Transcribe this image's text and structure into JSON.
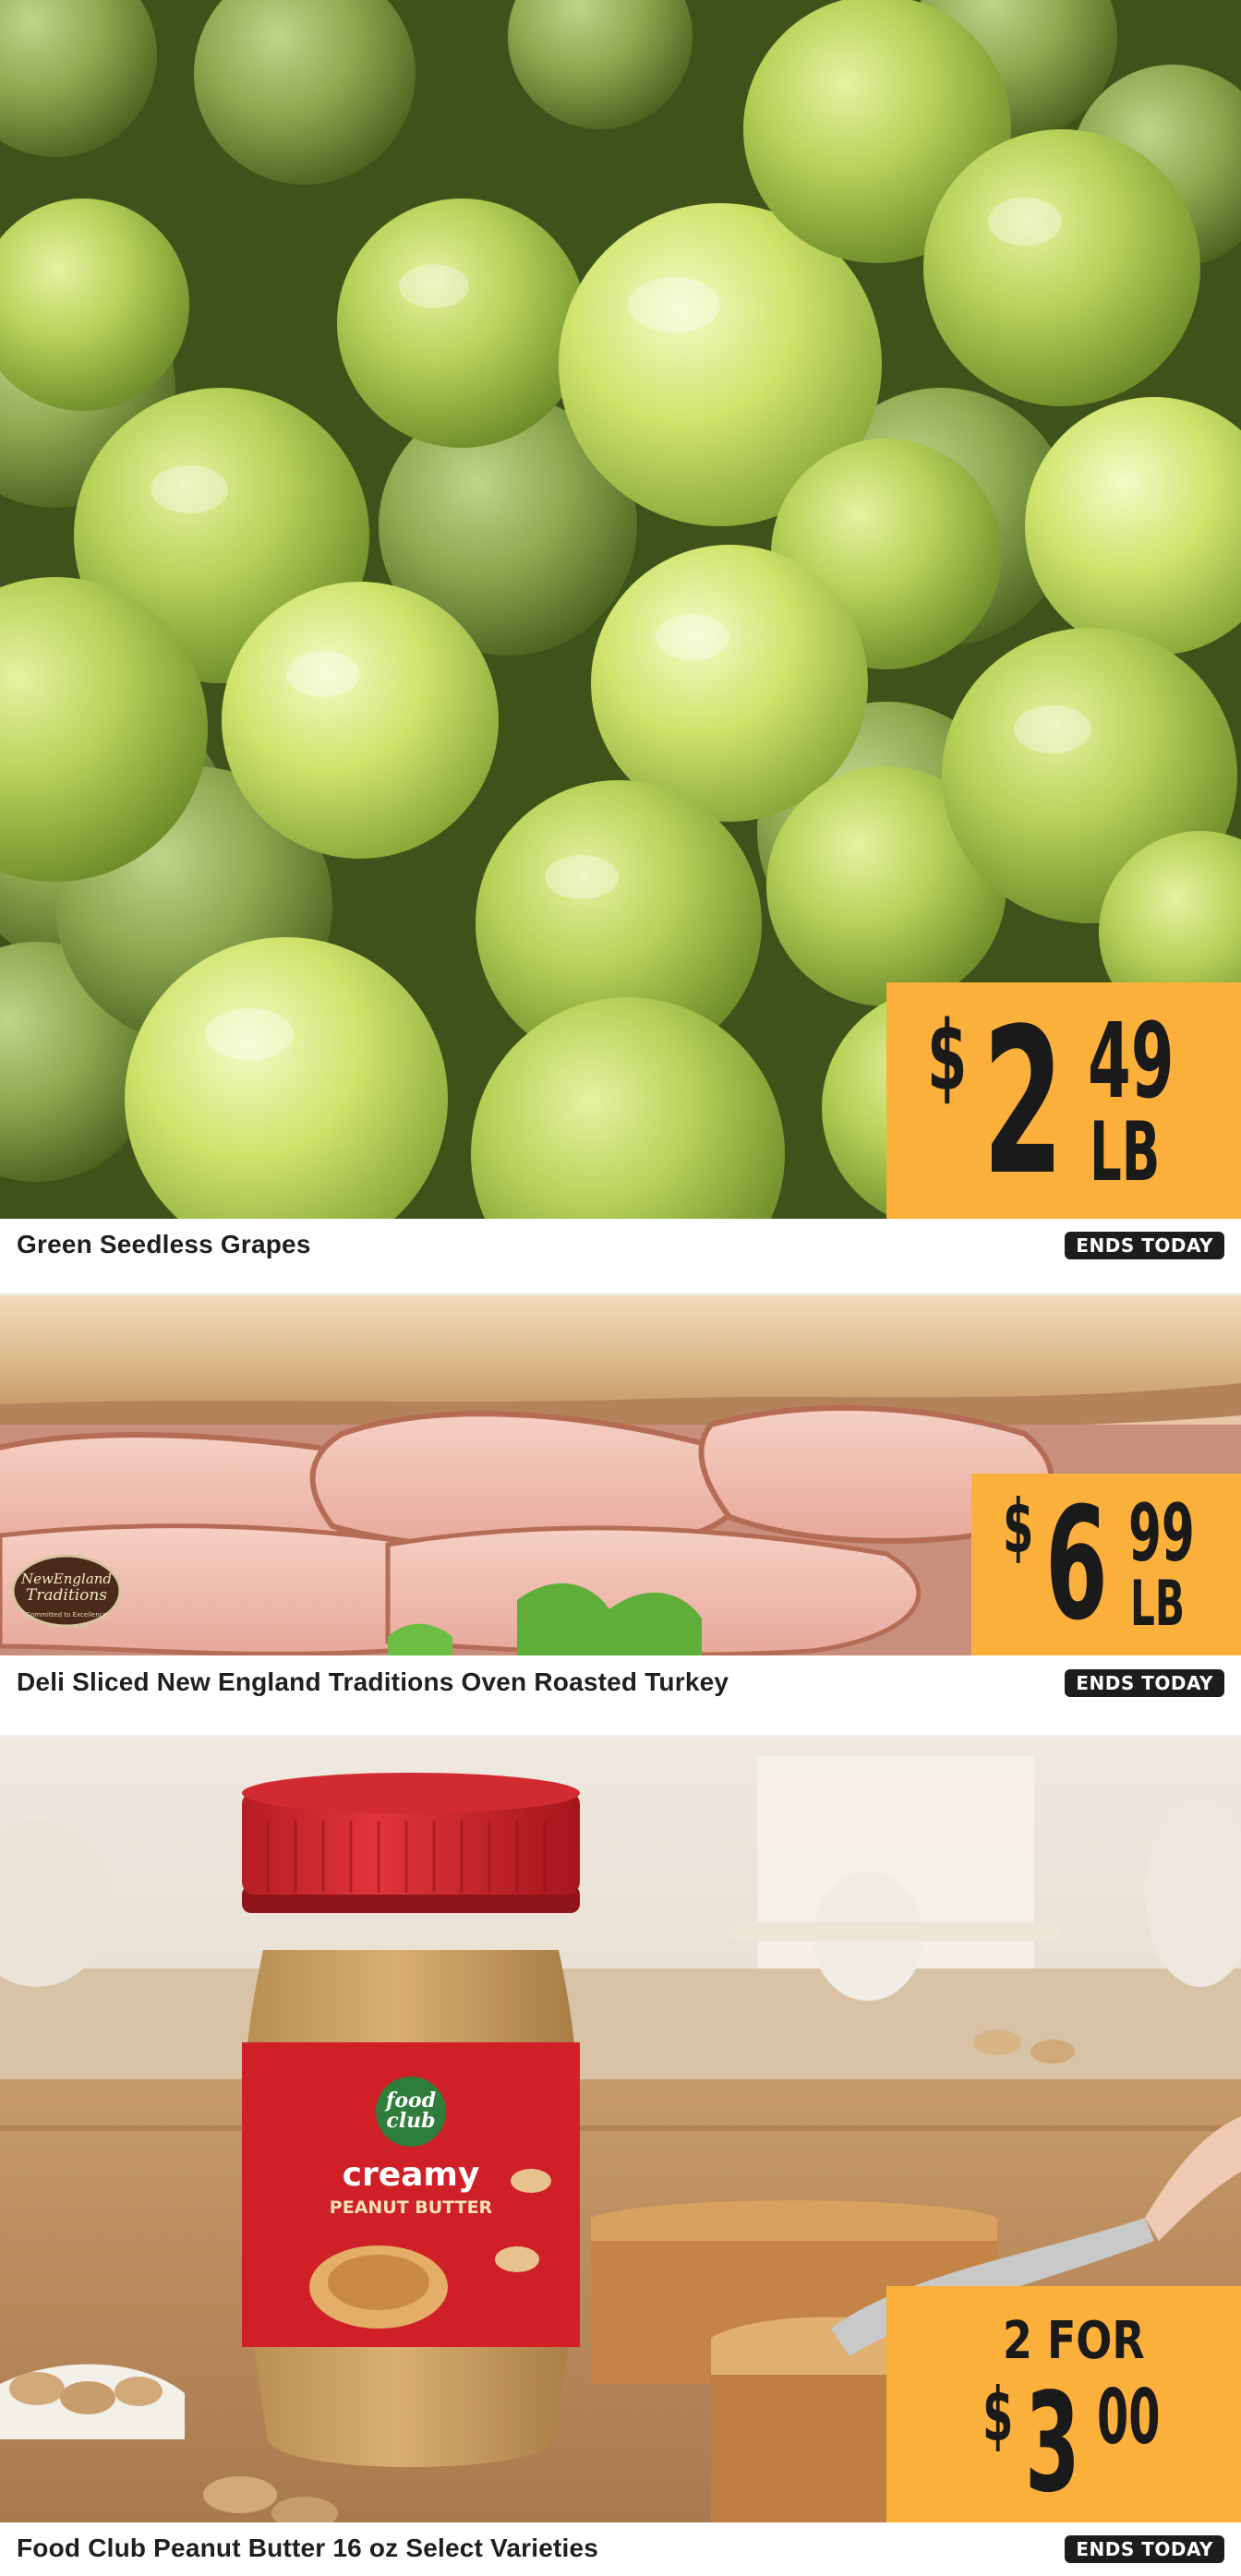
{
  "colors": {
    "price_tag": "#fbb03b",
    "badge_background": "#1d1d1d",
    "badge_text": "#ffffff",
    "product_text": "#1f1f1f"
  },
  "deals": [
    {
      "image_icon": "green-grapes-photo",
      "name": "Green Seedless Grapes",
      "badge": "ENDS TODAY",
      "price": {
        "dollar_sign": "$",
        "dollars": "2",
        "cents": "49",
        "unit": "LB"
      }
    },
    {
      "image_icon": "sliced-turkey-sandwich-photo",
      "logo_text": [
        "NewEngland",
        "Traditions",
        "Committed to Excellence"
      ],
      "name": "Deli Sliced New England Traditions Oven Roasted Turkey",
      "badge": "ENDS TODAY",
      "price": {
        "dollar_sign": "$",
        "dollars": "6",
        "cents": "99",
        "unit": "LB"
      }
    },
    {
      "image_icon": "peanut-butter-jar-photo",
      "jar_label": [
        "food",
        "club",
        "creamy",
        "PEANUT BUTTER"
      ],
      "name": "Food Club Peanut Butter 16 oz Select Varieties",
      "badge": "ENDS TODAY",
      "price": {
        "quantity": "2 FOR",
        "dollar_sign": "$",
        "dollars": "3",
        "cents": "00"
      }
    }
  ]
}
